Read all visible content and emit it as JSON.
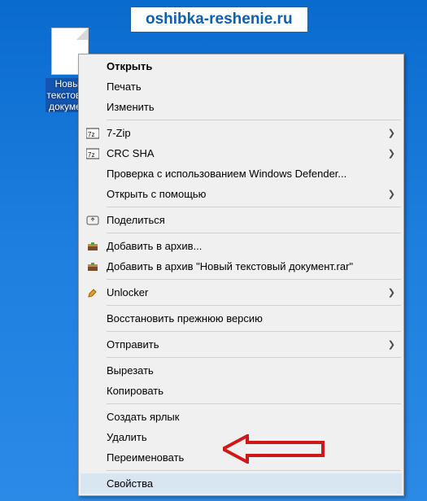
{
  "watermark": "oshibka-reshenie.ru",
  "desktop_file": {
    "label": "Новый текстовый документ"
  },
  "menu": {
    "open": "Открыть",
    "print": "Печать",
    "edit": "Изменить",
    "sevenzip": "7-Zip",
    "crcsha": "CRC SHA",
    "defender": "Проверка с использованием Windows Defender...",
    "openwith": "Открыть с помощью",
    "share": "Поделиться",
    "addarchive": "Добавить в архив...",
    "addrar": "Добавить в архив \"Новый текстовый документ.rar\"",
    "unlocker": "Unlocker",
    "restore": "Восстановить прежнюю версию",
    "sendto": "Отправить",
    "cut": "Вырезать",
    "copy": "Копировать",
    "shortcut": "Создать ярлык",
    "delete": "Удалить",
    "rename": "Переименовать",
    "properties": "Свойства"
  }
}
